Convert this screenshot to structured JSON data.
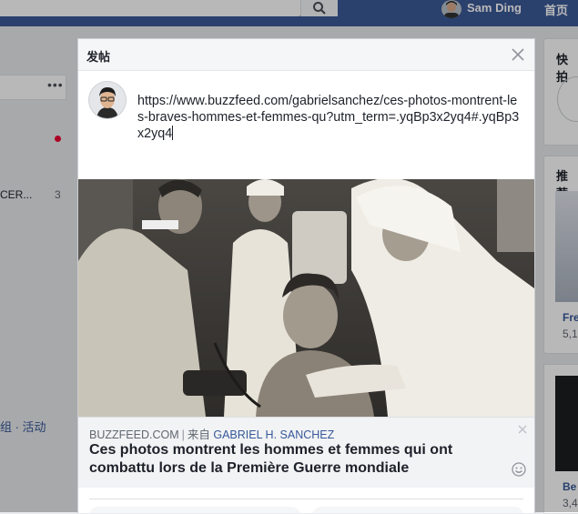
{
  "topbar": {
    "user_name": "Sam Ding",
    "home_label": "首页",
    "search_icon": "search-icon"
  },
  "left_column": {
    "more_label": "•••",
    "item_text": "CER...",
    "item_count": "3",
    "links_text": "组 · 活动"
  },
  "right_column": {
    "shortcuts_title": "快拍",
    "recommend_title": "推荐",
    "card1_name": "Fre",
    "card1_count": "5,1",
    "card2_name": "Be",
    "card2_count": "3,4"
  },
  "dialog": {
    "title": "发帖",
    "close_icon": "close-icon",
    "composer_text": "https://www.buzzfeed.com/gabrielsanchez/ces-photos-montrent-les-braves-hommes-et-femmes-qu?utm_term=.yqBp3x2yq4#.yqBp3x2yq4",
    "link_preview": {
      "site": "BUZZFEED.COM",
      "separator": "|",
      "from_label": "来自",
      "author": "GABRIEL H. SANCHEZ",
      "title": "Ces photos montrent les hommes et femmes qui ont combattu lors de la Première Guerre mondiale",
      "remove_icon": "close-icon",
      "emoji_icon": "smiley-icon"
    }
  }
}
